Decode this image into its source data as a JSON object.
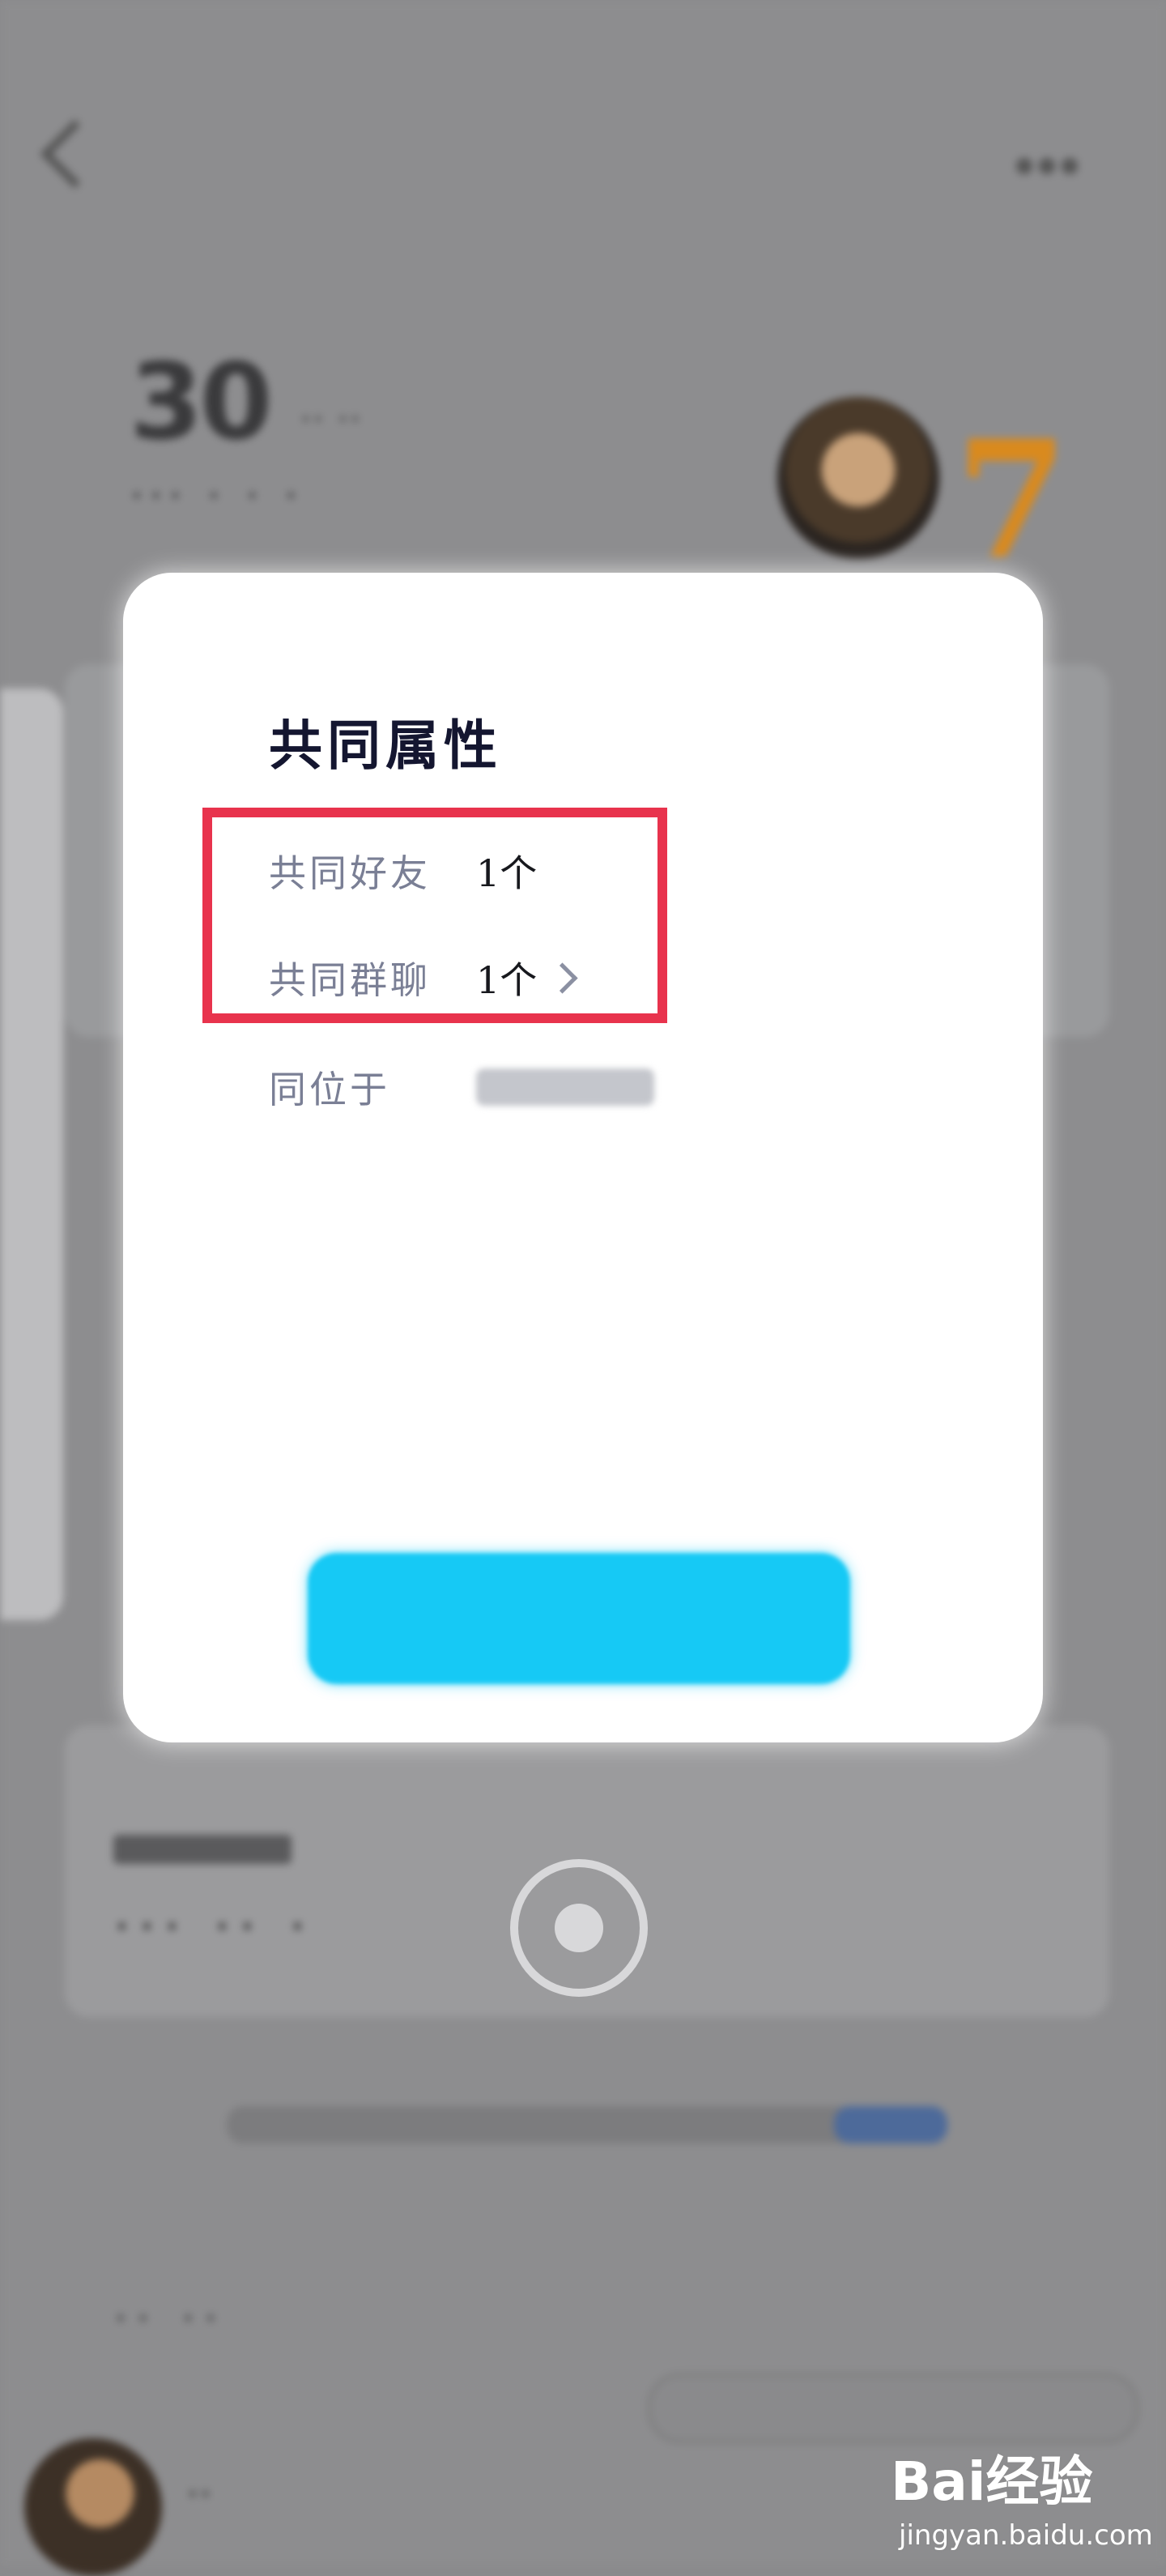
{
  "modal": {
    "title": "共同属性",
    "rows": [
      {
        "label": "共同好友",
        "value": "1个"
      },
      {
        "label": "共同群聊",
        "value": "1个"
      },
      {
        "label": "同位于",
        "value": ""
      }
    ],
    "button_label": ""
  },
  "watermark": {
    "logo": "Bai经验",
    "url": "jingyan.baidu.com"
  },
  "colors": {
    "highlight": "#e8334d",
    "button": "#16c9f5",
    "title": "#141630",
    "label": "#7a7f95"
  }
}
